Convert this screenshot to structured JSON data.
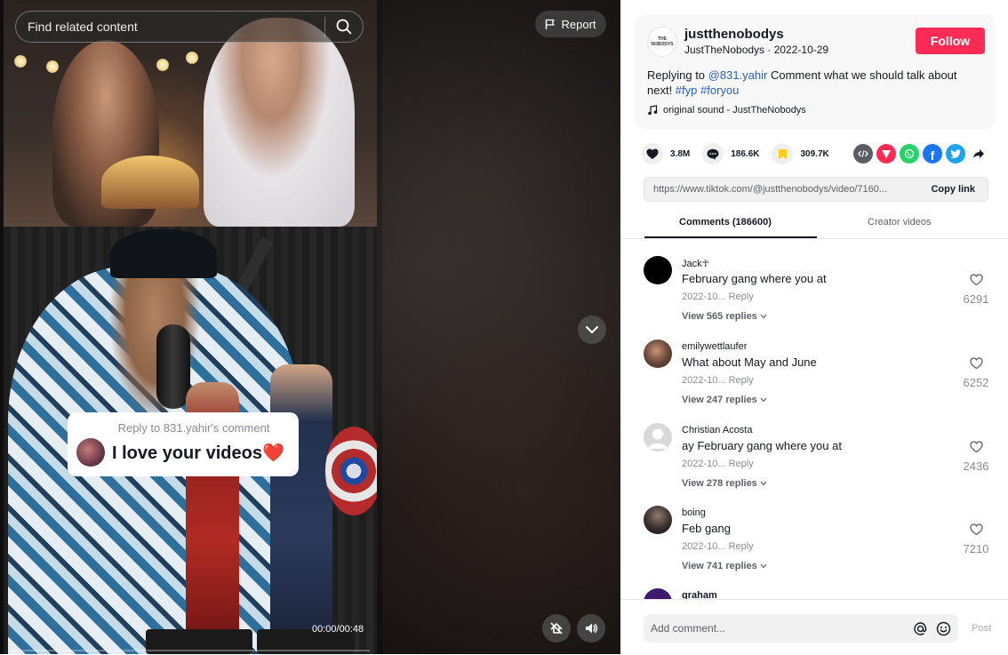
{
  "video": {
    "search_placeholder": "Find related content",
    "report_label": "Report",
    "reply_header": "Reply to 831.yahir's comment",
    "reply_text": "I love your videos❤️",
    "timestamp": "00:00/00:48",
    "progress": 0.0
  },
  "author": {
    "avatar_text": "THE NOBODYS",
    "username": "justthenobodys",
    "display_date": "JustTheNobodys · 2022-10-29",
    "follow_label": "Follow"
  },
  "description": {
    "prefix": "Replying to ",
    "mention": "@831.yahir",
    "body": " Comment what we should talk about next! ",
    "tag1": "#fyp",
    "tag2": "#foryou"
  },
  "sound": "original sound - JustTheNobodys",
  "stats": {
    "likes": "3.8M",
    "comments": "186.6K",
    "saves": "309.7K"
  },
  "share_icons": [
    "embed-icon",
    "send-icon",
    "whatsapp-icon",
    "facebook-icon",
    "twitter-icon",
    "share-arrow-icon"
  ],
  "copy_link": {
    "url": "https://www.tiktok.com/@justthenobodys/video/7160...",
    "button": "Copy link"
  },
  "tabs": {
    "comments": "Comments (186600)",
    "creator": "Creator videos"
  },
  "comments": [
    {
      "user": "Jack☥",
      "text": "February gang where you at",
      "date": "2022-10...",
      "reply": "Reply",
      "replies": "View 565 replies",
      "likes": "6291"
    },
    {
      "user": "emilywettlaufer",
      "text": "What about May and June",
      "date": "2022-10...",
      "reply": "Reply",
      "replies": "View 247 replies",
      "likes": "6252"
    },
    {
      "user": "Christian Acosta",
      "text": "ay February gang where you at",
      "date": "2022-10...",
      "reply": "Reply",
      "replies": "View 278 replies",
      "likes": "2436"
    },
    {
      "user": "boing",
      "text": "Feb gang",
      "date": "2022-10...",
      "reply": "Reply",
      "replies": "View 741 replies",
      "likes": "7210"
    },
    {
      "user": "graham",
      "text": "",
      "date": "",
      "reply": "",
      "replies": "",
      "likes": ""
    }
  ],
  "bottom": {
    "placeholder": "Add comment...",
    "post_label": "Post"
  },
  "colors": {
    "accent": "#fe2c55",
    "link": "#2b5db9",
    "save_yellow": "#face15"
  }
}
